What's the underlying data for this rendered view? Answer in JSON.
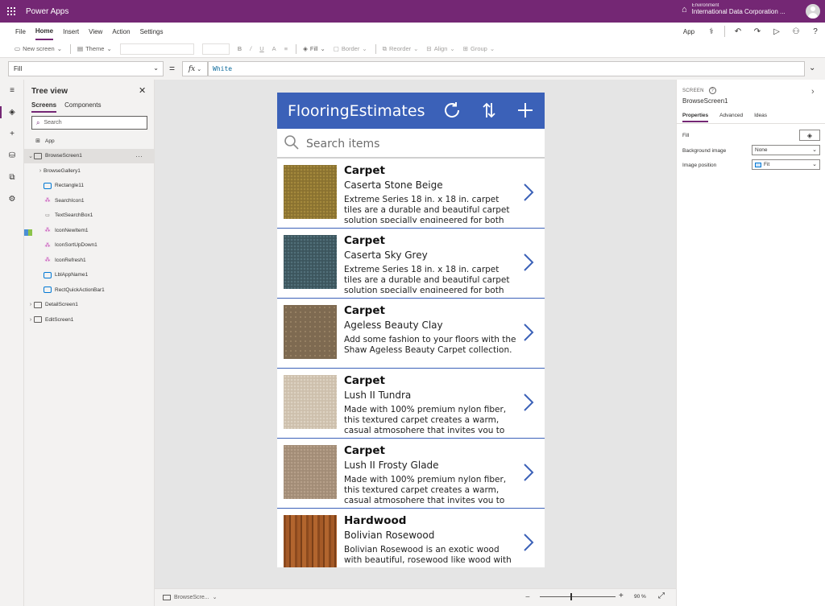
{
  "topbar": {
    "app_title": "Power Apps",
    "environment_label": "Environment",
    "environment_name": "International Data Corporation ..."
  },
  "menu": {
    "items": [
      "File",
      "Home",
      "Insert",
      "View",
      "Action",
      "Settings"
    ],
    "active": "Home",
    "app_label": "App"
  },
  "ribbon": {
    "new_screen": "New screen",
    "theme": "Theme",
    "bold": "B",
    "italic": "/",
    "underline": "U",
    "font_color": "A",
    "fill": "Fill",
    "border": "Border",
    "reorder": "Reorder",
    "align": "Align",
    "group": "Group"
  },
  "formula": {
    "property": "Fill",
    "fx": "fx",
    "value": "White"
  },
  "tree": {
    "title": "Tree view",
    "tabs": [
      "Screens",
      "Components"
    ],
    "search_placeholder": "Search",
    "nodes": [
      {
        "label": "App",
        "depth": 0,
        "icon": "app",
        "caret": ""
      },
      {
        "label": "BrowseScreen1",
        "depth": 0,
        "icon": "screen",
        "caret": "⌄",
        "selected": true,
        "more": "···"
      },
      {
        "label": "BrowseGallery1",
        "depth": 1,
        "icon": "gallery",
        "caret": "›"
      },
      {
        "label": "Rectangle11",
        "depth": 1,
        "icon": "rect",
        "caret": ""
      },
      {
        "label": "SearchIcon1",
        "depth": 1,
        "icon": "ic",
        "caret": ""
      },
      {
        "label": "TextSearchBox1",
        "depth": 1,
        "icon": "txt",
        "caret": ""
      },
      {
        "label": "IconNewItem1",
        "depth": 1,
        "icon": "ic",
        "caret": ""
      },
      {
        "label": "IconSortUpDown1",
        "depth": 1,
        "icon": "ic",
        "caret": ""
      },
      {
        "label": "IconRefresh1",
        "depth": 1,
        "icon": "ic",
        "caret": ""
      },
      {
        "label": "LblAppName1",
        "depth": 1,
        "icon": "rect",
        "caret": ""
      },
      {
        "label": "RectQuickActionBar1",
        "depth": 1,
        "icon": "rect",
        "caret": ""
      },
      {
        "label": "DetailScreen1",
        "depth": 0,
        "icon": "screen",
        "caret": "›"
      },
      {
        "label": "EditScreen1",
        "depth": 0,
        "icon": "screen",
        "caret": "›"
      }
    ]
  },
  "app": {
    "name": "FlooringEstimates",
    "search_placeholder": "Search items",
    "header_color": "#3b61b8",
    "items": [
      {
        "category": "Carpet",
        "name": "Caserta Stone Beige",
        "description": "Extreme Series 18 in. x 18 in. carpet tiles are a durable and beautiful carpet solution specially engineered for both",
        "swatch": "carpet-olive"
      },
      {
        "category": "Carpet",
        "name": "Caserta Sky Grey",
        "description": "Extreme Series 18 in. x 18 in. carpet tiles are a durable and beautiful carpet solution specially engineered for both",
        "swatch": "carpet-teal"
      },
      {
        "category": "Carpet",
        "name": "Ageless Beauty Clay",
        "description": "Add some fashion to your floors with the Shaw Ageless Beauty Carpet collection.",
        "swatch": "carpet-clay"
      },
      {
        "category": "Carpet",
        "name": "Lush II Tundra",
        "description": "Made with 100% premium nylon fiber, this textured carpet creates a warm, casual atmosphere that invites you to",
        "swatch": "carpet-cream"
      },
      {
        "category": "Carpet",
        "name": "Lush II Frosty Glade",
        "description": "Made with 100% premium nylon fiber, this textured carpet creates a warm, casual atmosphere that invites you to",
        "swatch": "carpet-tan"
      },
      {
        "category": "Hardwood",
        "name": "Bolivian Rosewood",
        "description": "Bolivian Rosewood is an exotic wood with beautiful, rosewood like wood with",
        "swatch": "wood-rose"
      }
    ]
  },
  "statusbar": {
    "screen": "BrowseScre...",
    "zoom": "90 %"
  },
  "properties": {
    "kind": "SCREEN",
    "name": "BrowseScreen1",
    "tabs": [
      "Properties",
      "Advanced",
      "Ideas"
    ],
    "fill_label": "Fill",
    "bg_image_label": "Background image",
    "bg_image_value": "None",
    "image_position_label": "Image position",
    "image_position_value": "Fit"
  }
}
